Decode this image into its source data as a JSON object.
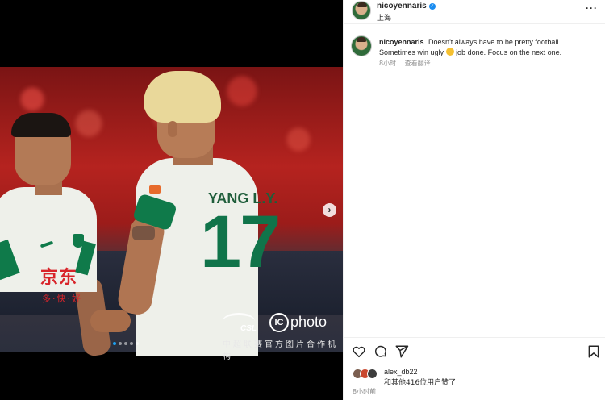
{
  "post": {
    "username": "nicoyennaris",
    "location": "上海",
    "more_label": "···",
    "caption_user": "nicoyennaris",
    "caption_text_1": "Doesn't always have to be pretty football. Sometimes win ugly",
    "caption_text_2": "job done. Focus on the next one.",
    "caption_time": "8小时",
    "translate_label": "查看翻译",
    "liked_by_user": "alex_db22",
    "liked_by_others": "和其他416位用户赞了",
    "post_time": "8小时前"
  },
  "media": {
    "sponsor_text": "京东",
    "sponsor_sub": "多·快·好",
    "jersey_name": "YANG L.Y.",
    "jersey_number": "17",
    "watermark_league": "CSL",
    "watermark_ic": "IC",
    "watermark_brand": "photo",
    "watermark_caption": "中超联赛官方图片合作机构",
    "next_arrow": "›",
    "slide_count": 5,
    "active_slide": 1
  },
  "icons": {
    "heart": "heart-icon",
    "comment": "comment-icon",
    "share": "share-icon",
    "save": "bookmark-icon",
    "verified": "verified-badge-icon"
  },
  "colors": {
    "verified_blue": "#1a8cf0",
    "meta_gray": "#8e8e8e",
    "jersey_green": "#10744a",
    "sponsor_red": "#d8242a"
  }
}
